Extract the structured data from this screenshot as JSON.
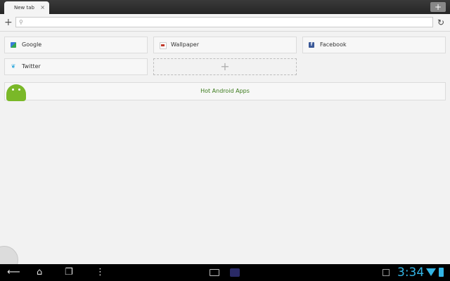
{
  "tabs": [
    {
      "label": "New tab",
      "close_glyph": "×"
    }
  ],
  "tabbar": {
    "new_tab_glyph": "+",
    "new_tab_icon": "plus-icon"
  },
  "urlbar": {
    "add_glyph": "+",
    "search_glyph": "⚲",
    "value": "",
    "reload_glyph": "↻"
  },
  "speed_dial": [
    {
      "label": "Google",
      "icon": "google-icon",
      "glyph": ""
    },
    {
      "label": "Wallpaper",
      "icon": "wallpaper-icon",
      "glyph": ""
    },
    {
      "label": "Facebook",
      "icon": "facebook-icon",
      "glyph": "f"
    },
    {
      "label": "Twitter",
      "icon": "twitter-icon",
      "glyph": "❦"
    }
  ],
  "add_tile": {
    "glyph": "+"
  },
  "apps_banner": {
    "label": "Hot Android Apps",
    "color": "#3a7a1a"
  },
  "system_bar": {
    "back_glyph": "⟵",
    "home_glyph": "⌂",
    "recent_glyph": "❐",
    "menu_glyph": "⋮",
    "clock": "3:34",
    "clock_color": "#33b5e5"
  }
}
